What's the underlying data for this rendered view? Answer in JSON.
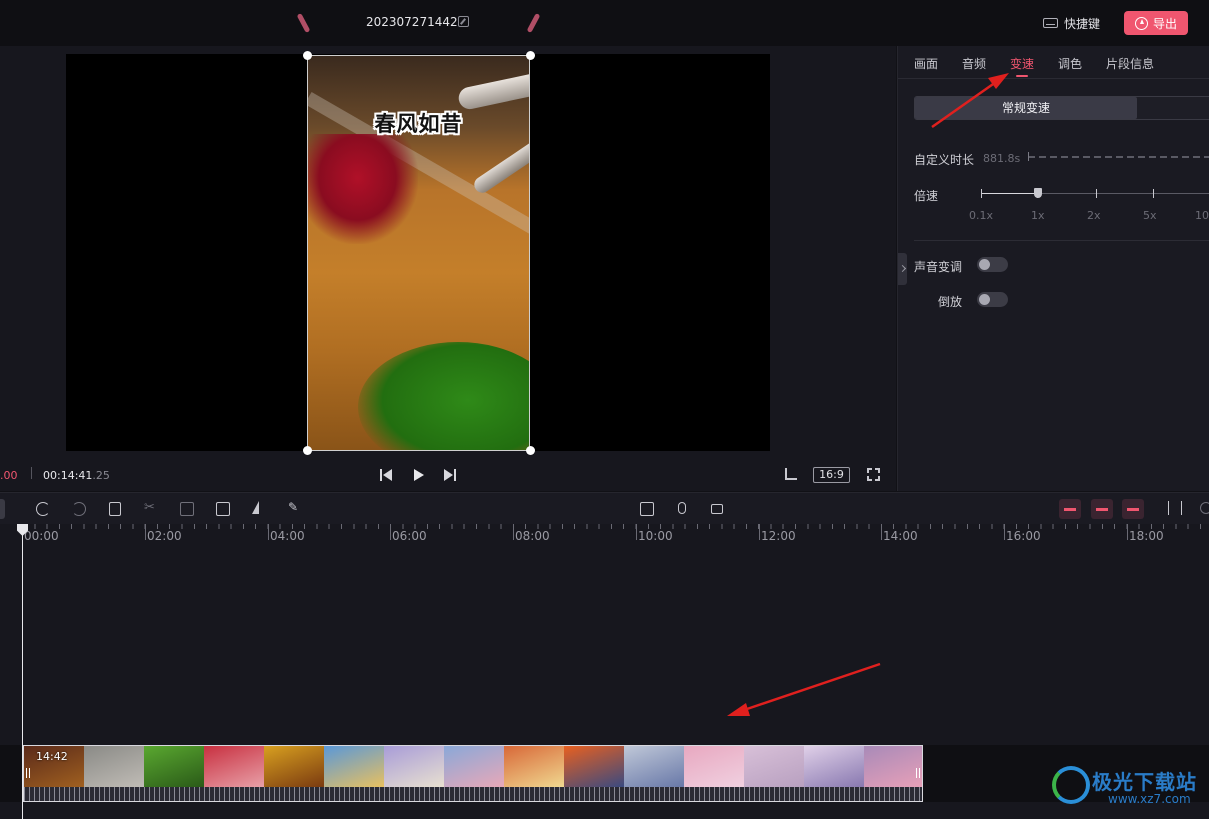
{
  "header": {
    "project_title": "202307271442",
    "shortcut_label": "快捷键",
    "export_label": "导出"
  },
  "player": {
    "subtitle_text": "春风如昔",
    "current_time": ".00",
    "total_time": "00:14:41",
    "total_frames": ".25",
    "ratio_label": "16:9"
  },
  "panel": {
    "tabs": [
      "画面",
      "音频",
      "变速",
      "调色",
      "片段信息"
    ],
    "active_tab": "变速",
    "segment_active": "常规变速",
    "custom_duration_label": "自定义时长",
    "custom_duration_value": "881.8s",
    "speed_label": "倍速",
    "speed_ticks": [
      "0.1x",
      "1x",
      "2x",
      "5x",
      "10"
    ],
    "speed_value": "1x",
    "pitch_label": "声音变调",
    "reverse_label": "倒放",
    "pitch_enabled": false,
    "reverse_enabled": false
  },
  "timeline": {
    "ruler_labels": [
      "00:00",
      "02:00",
      "04:00",
      "06:00",
      "08:00",
      "10:00",
      "12:00",
      "14:00",
      "16:00",
      "18:00"
    ],
    "clip_duration": "14:42"
  },
  "watermark": {
    "name": "极光下载站",
    "url": "www.xz7.com"
  },
  "colors": {
    "accent": "#f0566f",
    "annotation_arrow": "#e0201e"
  }
}
